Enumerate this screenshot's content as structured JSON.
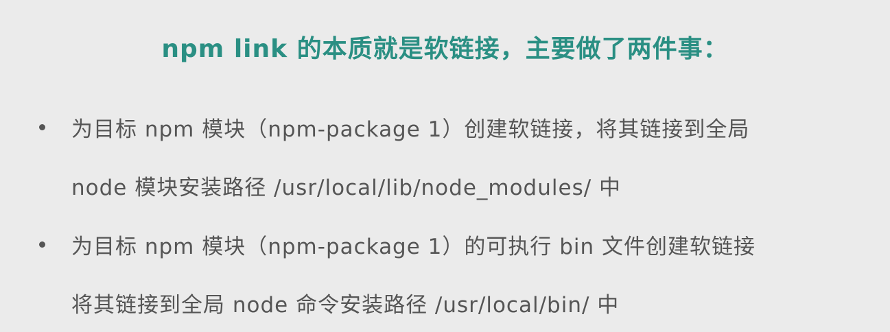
{
  "title": "npm link 的本质就是软链接，主要做了两件事：",
  "bullets": [
    {
      "line1": "为目标 npm 模块（npm-package 1）创建软链接，将其链接到全局",
      "line2": "node 模块安装路径 /usr/local/lib/node_modules/ 中"
    },
    {
      "line1": "为目标 npm 模块（npm-package 1）的可执行 bin 文件创建软链接",
      "line2": "将其链接到全局 node 命令安装路径 /usr/local/bin/ 中"
    }
  ],
  "colors": {
    "background": "#ebebeb",
    "title": "#2a8f83",
    "body_text": "#555555"
  }
}
